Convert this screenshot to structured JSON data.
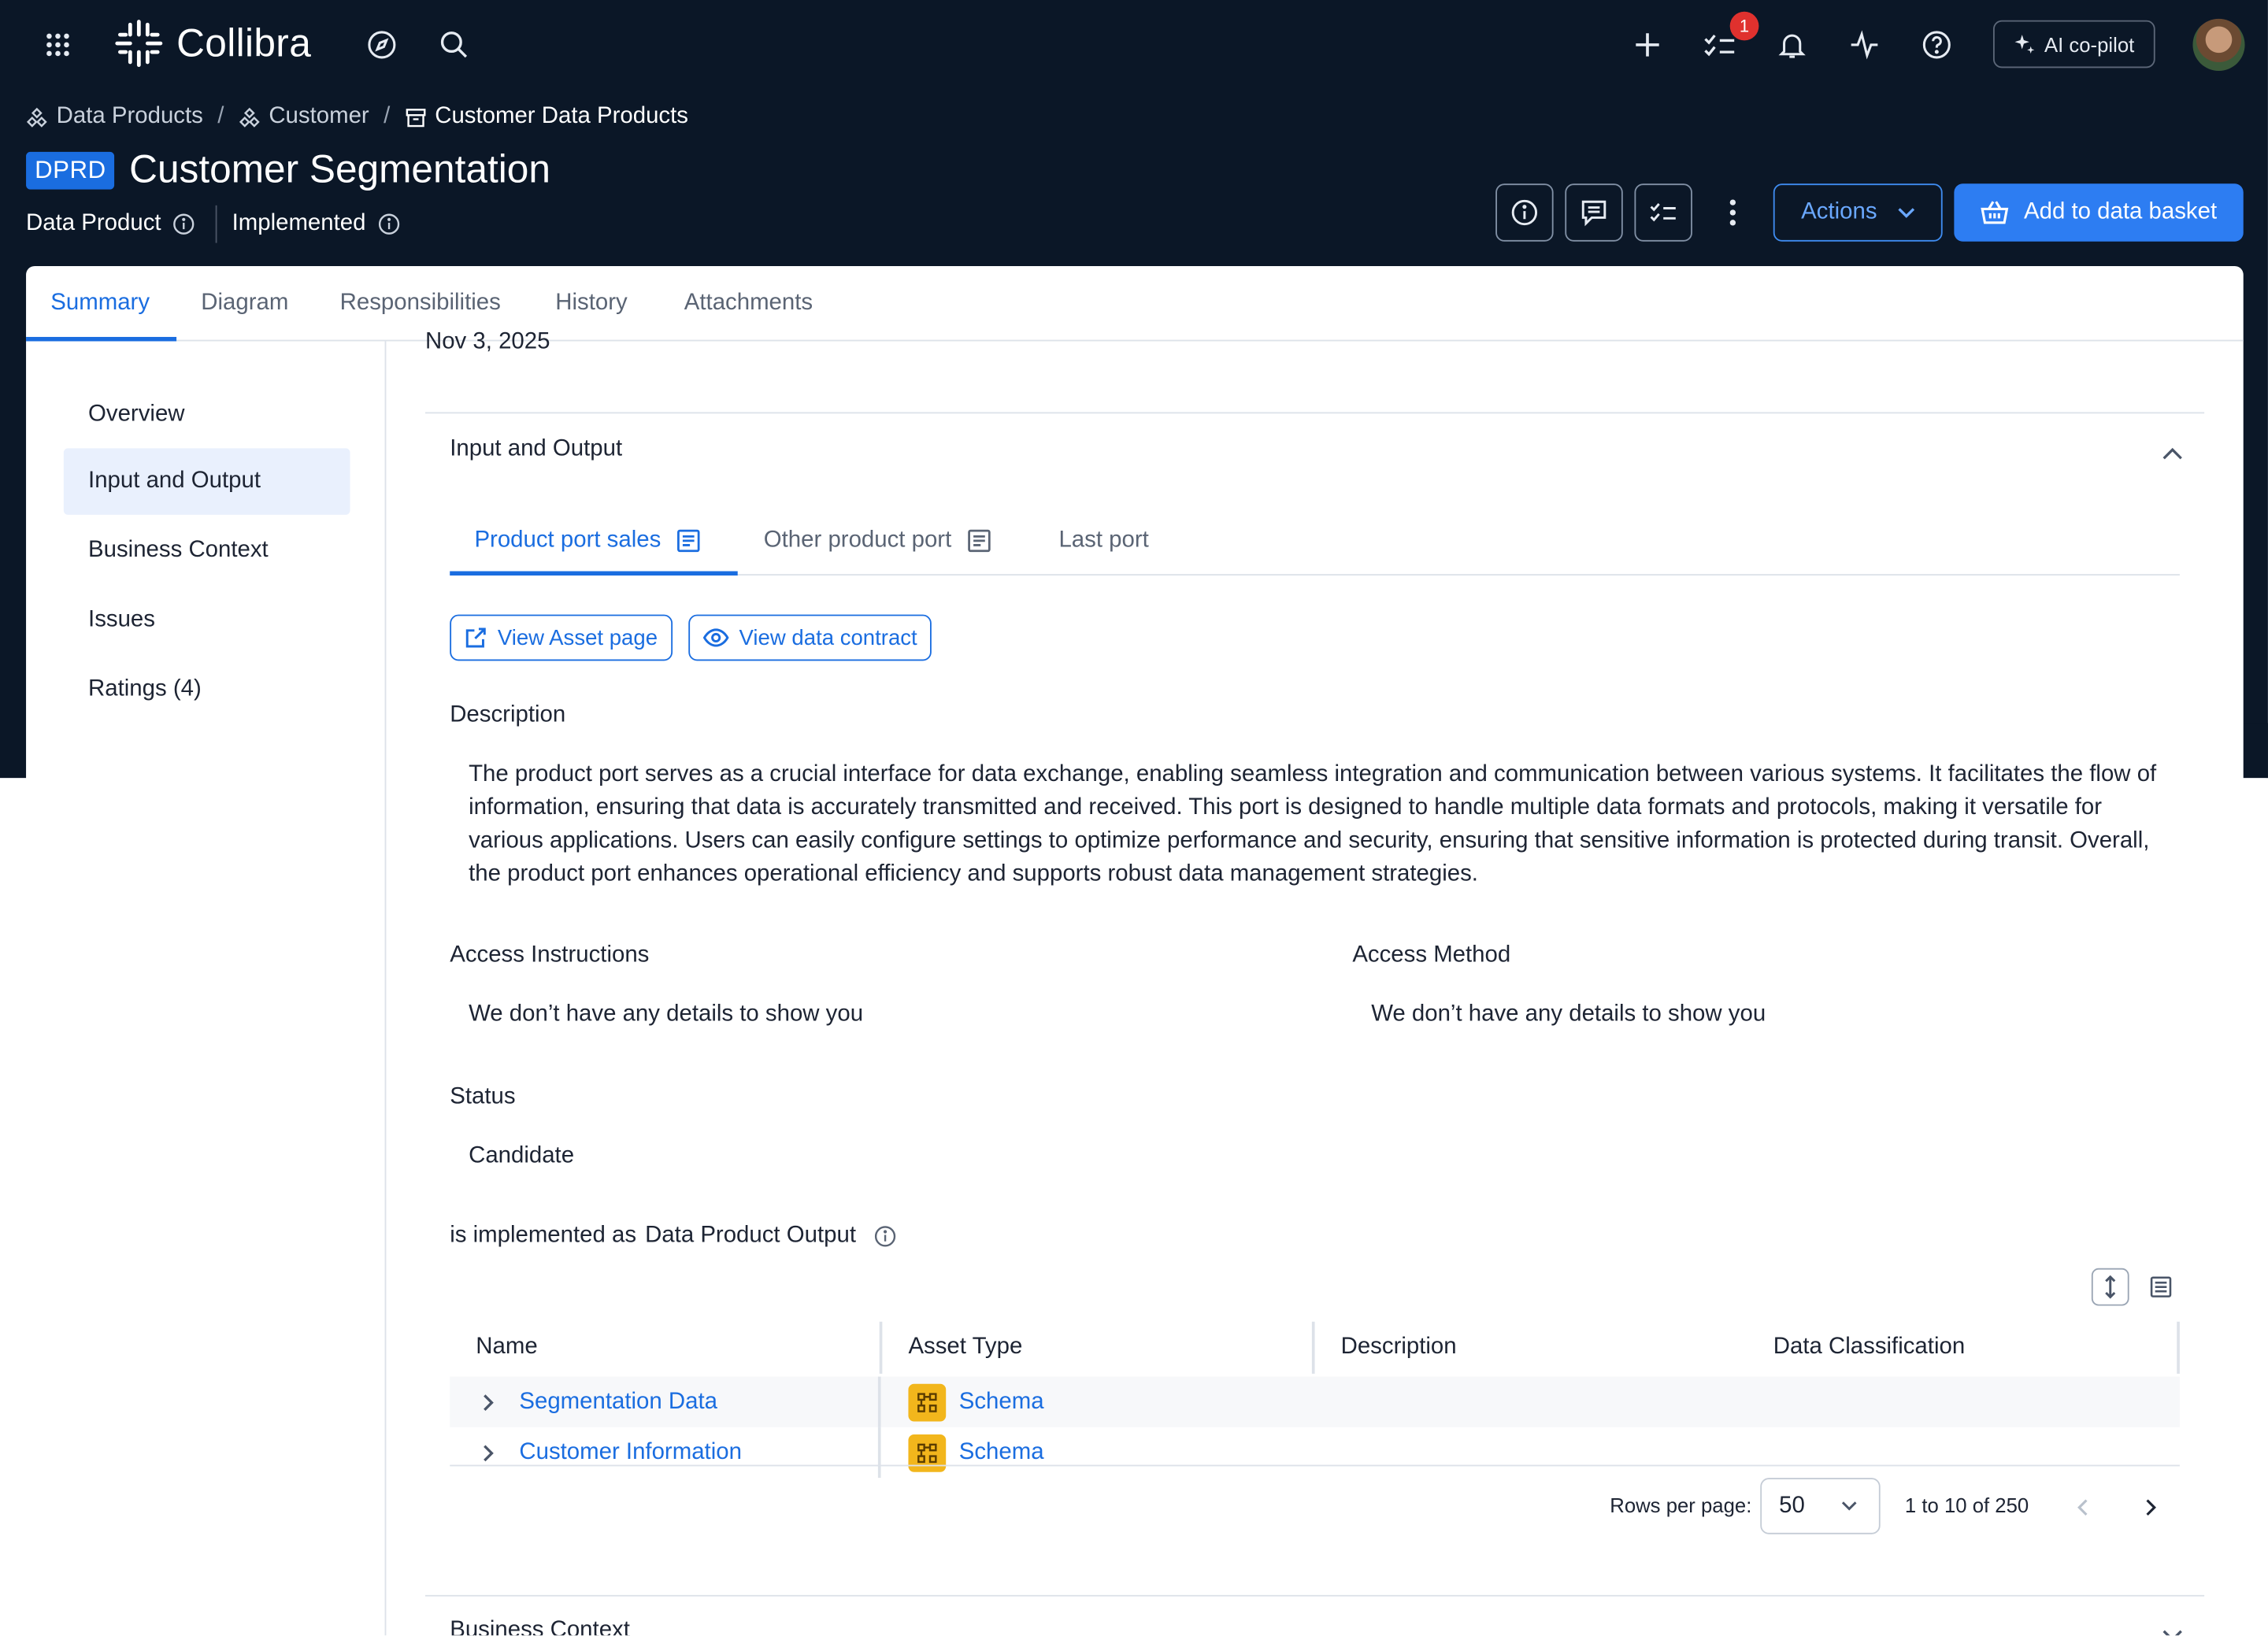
{
  "topnav": {
    "logo_text": "Collibra",
    "notification_count": "1",
    "copilot_label": "AI co-pilot"
  },
  "breadcrumb": [
    {
      "label": "Data Products",
      "icon": "data-product-icon"
    },
    {
      "label": "Customer",
      "icon": "data-product-icon"
    },
    {
      "label": "Customer Data Products",
      "icon": "archive-icon"
    }
  ],
  "header": {
    "badge": "DPRD",
    "title": "Customer Segmentation",
    "asset_type": "Data Product",
    "status": "Implemented",
    "actions_label": "Actions",
    "basket_label": "Add to data basket"
  },
  "tabs": [
    "Summary",
    "Diagram",
    "Responsibilities",
    "History",
    "Attachments"
  ],
  "sidenav": [
    "Overview",
    "Input and Output",
    "Business Context",
    "Issues",
    "Ratings (4)"
  ],
  "content": {
    "cut_date": "Nov 3, 2025",
    "section_title": "Input and Output",
    "subtabs": [
      "Product port sales",
      "Other product port",
      "Last port"
    ],
    "view_asset_label": "View Asset page",
    "view_contract_label": "View data contract",
    "description_label": "Description",
    "description_text": "The product port serves as a crucial interface for data exchange, enabling seamless integration and communication between various systems. It facilitates the flow of information, ensuring that data is accurately transmitted and received. This port is designed to handle multiple data formats and protocols, making it versatile for various applications. Users can easily configure settings to optimize performance and security, ensuring that sensitive information is protected during transit. Overall, the product port enhances operational efficiency and supports robust data management strategies.",
    "access_instructions_label": "Access Instructions",
    "access_instructions_value": "We don’t have any details to show you",
    "access_method_label": "Access Method",
    "access_method_value": "We don’t have any details to show you",
    "status_label": "Status",
    "status_value": "Candidate",
    "relation_bold": "is implemented as",
    "relation_target": "Data Product Output",
    "next_section_title": "Business Context"
  },
  "table": {
    "columns": [
      "Name",
      "Asset Type",
      "Description",
      "Data Classification"
    ],
    "rows": [
      {
        "name": "Segmentation Data",
        "asset_type": "Schema"
      },
      {
        "name": "Customer Information",
        "asset_type": "Schema"
      }
    ],
    "rows_per_page_label": "Rows per page:",
    "rows_per_page": "50",
    "range_text": "1 to 10 of 250"
  },
  "colors": {
    "nav_bg": "#0b1727",
    "accent": "#1a6de0",
    "primary_button": "#2d7df2",
    "schema_icon": "#f2b61c",
    "badge_red": "#e0312e"
  }
}
